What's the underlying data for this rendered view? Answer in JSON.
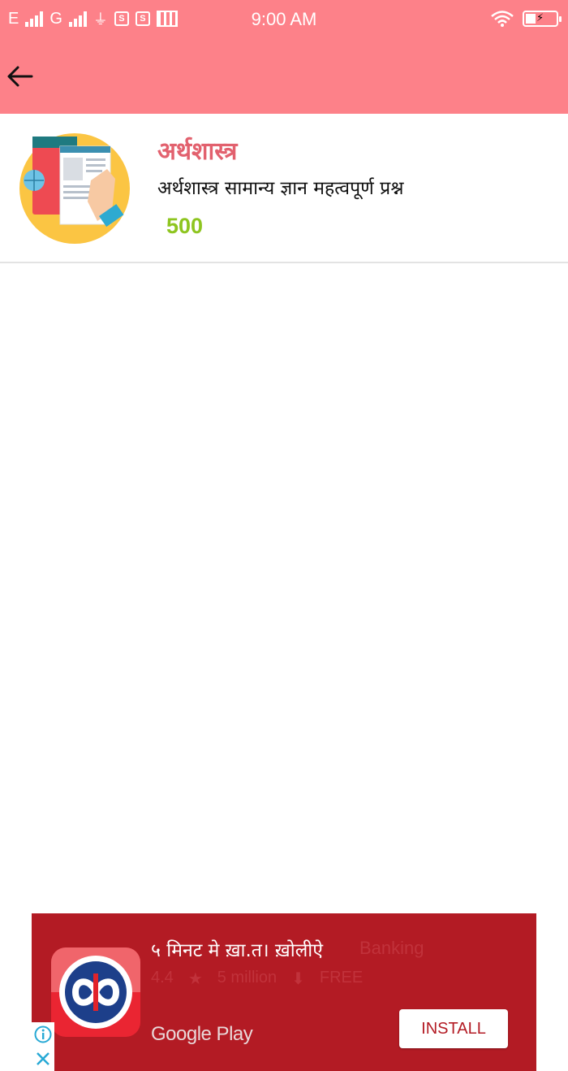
{
  "status_bar": {
    "network_1": "E",
    "network_2": "G",
    "time": "9:00 AM",
    "icons": [
      "signal-icon",
      "signal-icon",
      "usb-icon",
      "notification-icon",
      "notification-icon",
      "film-icon",
      "wifi-icon",
      "battery-icon"
    ],
    "battery_level": 0.3
  },
  "toolbar": {
    "back_icon": "arrow-left-icon"
  },
  "category": {
    "title": "अर्थशास्त्र",
    "subtitle": "अर्थशास्त्र सामान्य ज्ञान महत्वपूर्ण प्रश्न",
    "count": "500",
    "thumbnail_icon": "document-touch-icon"
  },
  "ad": {
    "headline": "५ मिनट मे ख़ा.त। ख़ोलीऐ",
    "ghost_text": "Banking",
    "meta_rating": "4.4",
    "meta_downloads": "5 million",
    "meta_price": "FREE",
    "store": "Google Play",
    "install_label": "INSTALL",
    "app_icon": "kotak-logo-icon",
    "colors": {
      "background": "#b31b24",
      "icon_bg": "#ea2532"
    }
  },
  "colors": {
    "accent": "#fd8189",
    "title": "#e2616e",
    "count": "#8ec520"
  }
}
